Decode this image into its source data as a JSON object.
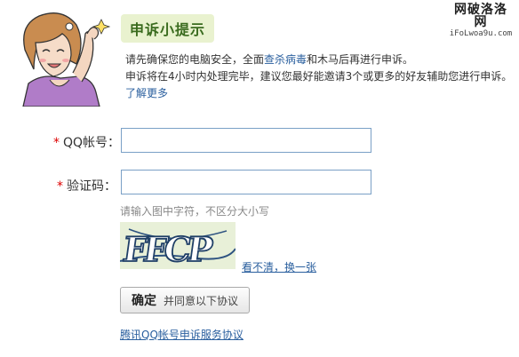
{
  "watermark": {
    "cn": "网破洛洛网",
    "en": "iFoLwoa9u.com"
  },
  "tips": {
    "title": "申诉小提示",
    "line1_pre": "请先确保您的电脑安全，全面",
    "line1_link": "查杀病毒",
    "line1_post": "和木马后再进行申诉。",
    "line2": "申诉将在4小时内处理完毕，建议您最好能邀请3个或更多的好友辅助您进行申诉。",
    "learn_more": "了解更多"
  },
  "form": {
    "required_mark": "*",
    "qq_label": "QQ帐号：",
    "qq_value": "",
    "captcha_label": "验证码：",
    "captcha_value": "",
    "captcha_hint": "请输入图中字符，不区分大小写",
    "captcha_text": "FFCP",
    "refresh_link": "看不清，换一张"
  },
  "submit": {
    "primary": "确定",
    "secondary": "并同意以下协议"
  },
  "agreement_link": "腾讯QQ帐号申诉服务协议"
}
